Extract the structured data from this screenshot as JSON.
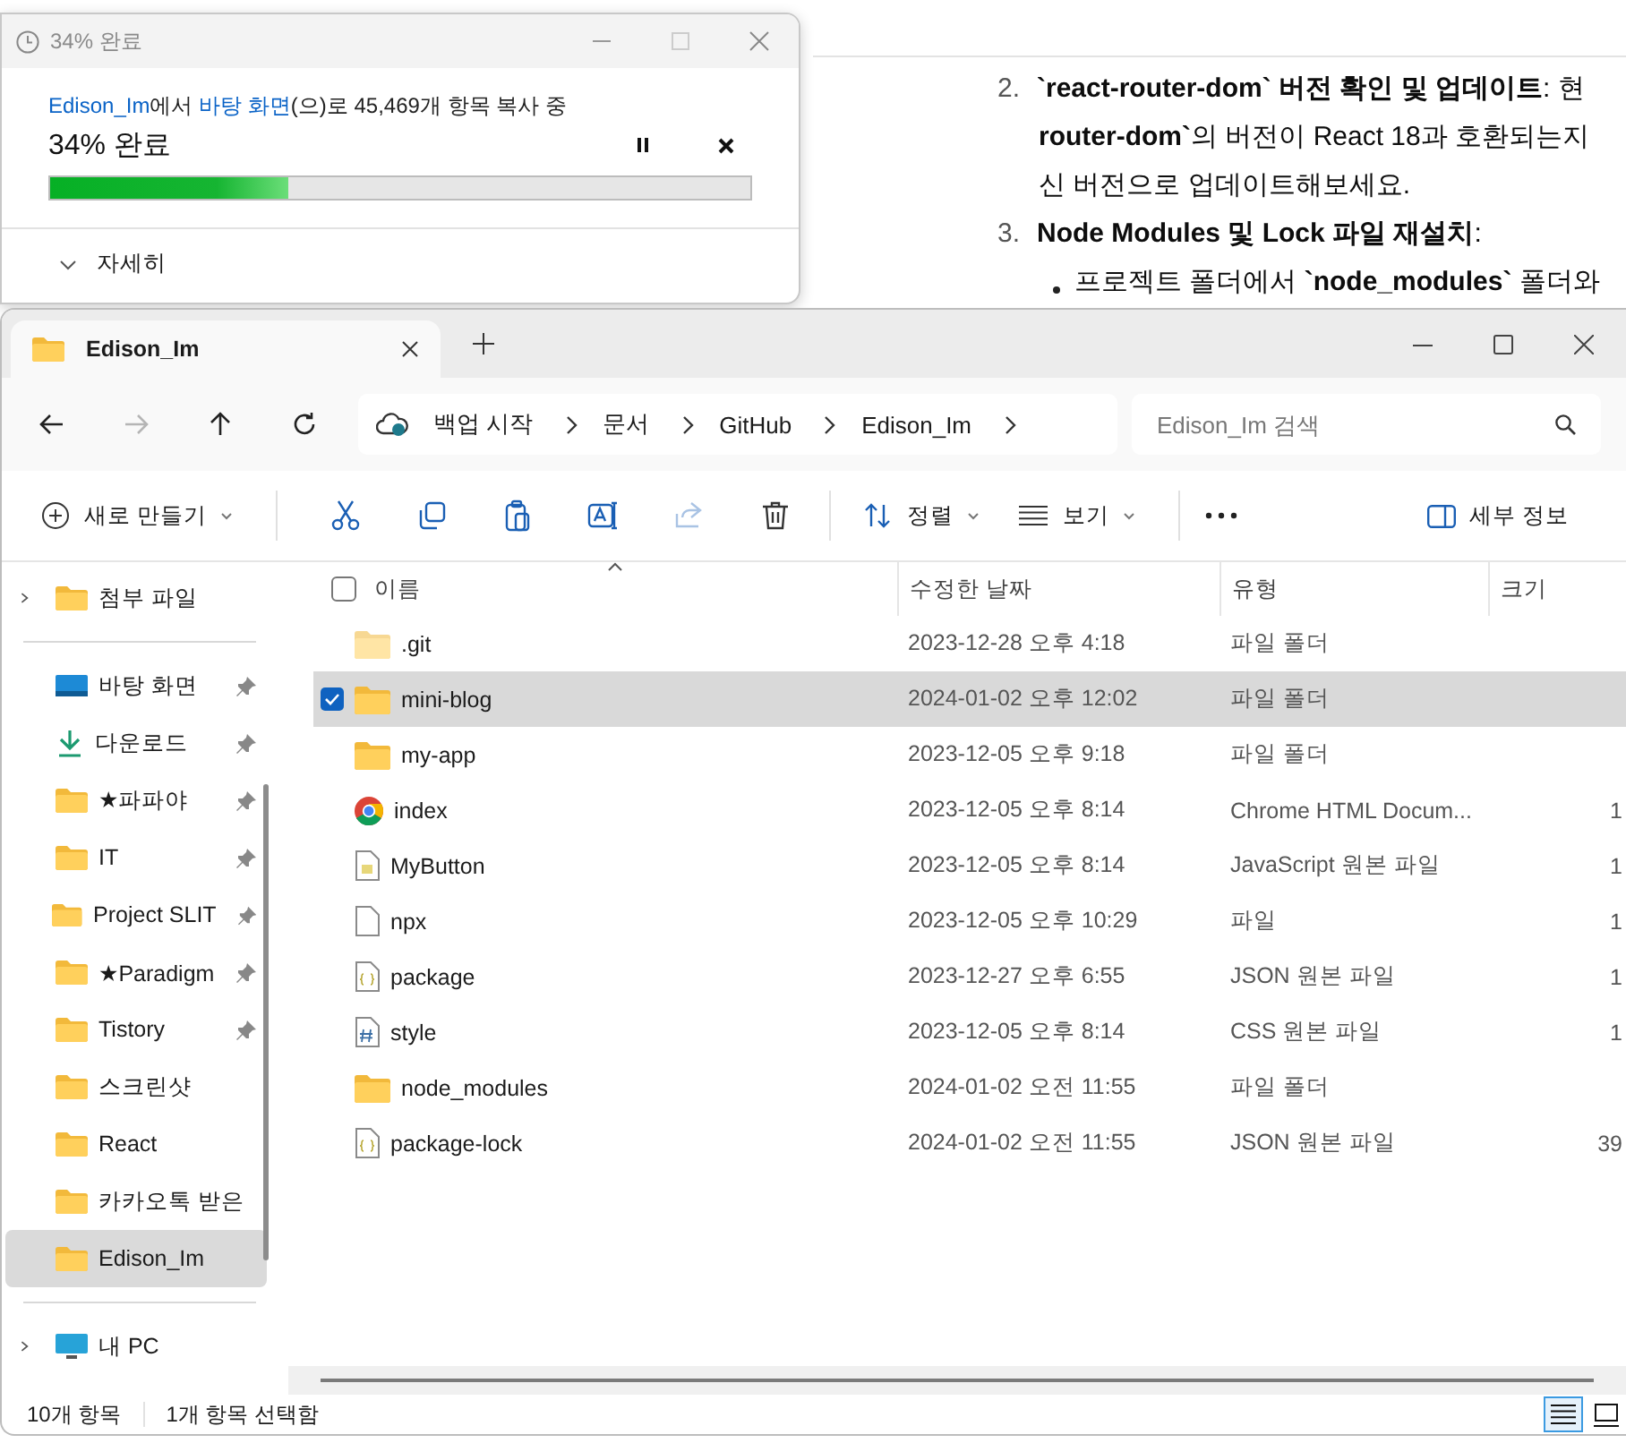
{
  "article": {
    "lines": [
      {
        "kind": "numbered",
        "marker": "2.",
        "text": "**`react-router-dom` 버전 확인 및 업데이트**: 현"
      },
      {
        "kind": "cont",
        "text": "**router-dom`**의 버전이 React 18과 호환되는지"
      },
      {
        "kind": "cont",
        "text": "신 버전으로 업데이트해보세요."
      },
      {
        "kind": "numbered",
        "marker": "3.",
        "text": "**Node Modules 및 Lock 파일 재설치**:"
      },
      {
        "kind": "bullet",
        "text": "프로젝트 폴더에서 **`node_modules`** 폴더와"
      }
    ]
  },
  "copy_dialog": {
    "title": "34% 완료",
    "message": [
      {
        "kind": "link",
        "text": "Edison_Im"
      },
      {
        "kind": "plain",
        "text": "에서 "
      },
      {
        "kind": "link",
        "text": "바탕 화면"
      },
      {
        "kind": "plain",
        "text": "(으)로 45,469개 항목 복사 중"
      }
    ],
    "status": "34% 완료",
    "level": 0.34,
    "details": "자세히"
  },
  "explorer": {
    "tabs": [
      {
        "label": "Edison_Im",
        "selected": true
      }
    ],
    "nav": [
      {
        "kind": "back",
        "disabled": false
      },
      {
        "kind": "forward",
        "disabled": true
      },
      {
        "kind": "up",
        "disabled": false
      },
      {
        "kind": "refresh",
        "disabled": false
      }
    ],
    "breadcrumb": [
      "백업 시작",
      "문서",
      "GitHub",
      "Edison_Im"
    ],
    "search": {
      "placeholder": "Edison_Im 검색"
    },
    "toolbar": {
      "new": "새로 만들기",
      "tools": [
        {
          "kind": "cut",
          "disabled": false
        },
        {
          "kind": "copy",
          "disabled": false
        },
        {
          "kind": "paste",
          "disabled": false
        },
        {
          "kind": "rename",
          "disabled": false
        },
        {
          "kind": "share",
          "disabled": true
        },
        {
          "kind": "delete",
          "disabled": false
        }
      ],
      "sort": "정렬",
      "view": "보기",
      "details": "세부 정보"
    },
    "sidebar": {
      "sections": [
        {
          "items": [
            {
              "label": "첨부 파일",
              "kind": "folder",
              "expanded": false,
              "pinned": false,
              "selected": false
            }
          ]
        },
        {
          "items": [
            {
              "label": "바탕 화면",
              "kind": "desktop",
              "pinned": true,
              "selected": false
            },
            {
              "label": "다운로드",
              "kind": "download",
              "pinned": true,
              "selected": false
            },
            {
              "label": "★파파야",
              "kind": "folder",
              "pinned": true,
              "selected": false
            },
            {
              "label": "IT",
              "kind": "folder",
              "pinned": true,
              "selected": false
            },
            {
              "label": "Project SLIT",
              "kind": "folder",
              "pinned": true,
              "selected": false
            },
            {
              "label": "★Paradigm",
              "kind": "folder",
              "pinned": true,
              "selected": false
            },
            {
              "label": "Tistory",
              "kind": "folder",
              "pinned": true,
              "selected": false
            },
            {
              "label": "스크린샷",
              "kind": "folder",
              "pinned": false,
              "selected": false
            },
            {
              "label": "React",
              "kind": "folder",
              "pinned": false,
              "selected": false
            },
            {
              "label": "카카오톡 받은",
              "kind": "folder",
              "pinned": false,
              "selected": false
            },
            {
              "label": "Edison_Im",
              "kind": "folder",
              "pinned": false,
              "selected": true
            }
          ]
        },
        {
          "items": [
            {
              "label": "내 PC",
              "kind": "pc",
              "expanded": false,
              "pinned": false,
              "selected": false
            }
          ]
        }
      ]
    },
    "table": {
      "columns": [
        "이름",
        "수정한 날짜",
        "유형",
        "크기"
      ],
      "all_selected": false,
      "rows": [
        {
          "name": ".git",
          "kind": "folder-light",
          "date": "2023-12-28 오후 4:18",
          "type": "파일 폴더",
          "selected": false
        },
        {
          "name": "mini-blog",
          "kind": "folder",
          "date": "2024-01-02 오후 12:02",
          "type": "파일 폴더",
          "selected": true
        },
        {
          "name": "my-app",
          "kind": "folder",
          "date": "2023-12-05 오후 9:18",
          "type": "파일 폴더",
          "selected": false
        },
        {
          "name": "index",
          "kind": "chrome",
          "date": "2023-12-05 오후 8:14",
          "type": "Chrome HTML Docum...",
          "size": "1",
          "selected": false
        },
        {
          "name": "MyButton",
          "kind": "js",
          "date": "2023-12-05 오후 8:14",
          "type": "JavaScript 원본 파일",
          "size": "1",
          "selected": false
        },
        {
          "name": "npx",
          "kind": "file",
          "date": "2023-12-05 오후 10:29",
          "type": "파일",
          "size": "1",
          "selected": false
        },
        {
          "name": "package",
          "kind": "json",
          "date": "2023-12-27 오후 6:55",
          "type": "JSON 원본 파일",
          "size": "1",
          "selected": false
        },
        {
          "name": "style",
          "kind": "css",
          "date": "2023-12-05 오후 8:14",
          "type": "CSS 원본 파일",
          "size": "1",
          "selected": false
        },
        {
          "name": "node_modules",
          "kind": "folder",
          "date": "2024-01-02 오전 11:55",
          "type": "파일 폴더",
          "selected": false
        },
        {
          "name": "package-lock",
          "kind": "json",
          "date": "2024-01-02 오전 11:55",
          "type": "JSON 원본 파일",
          "size": "39",
          "selected": false
        }
      ]
    },
    "status_bar": {
      "count": "10개 항목",
      "selection": "1개 항목 선택함",
      "views": [
        {
          "kind": "details",
          "selected": true
        },
        {
          "kind": "tiles",
          "selected": false
        }
      ]
    }
  }
}
